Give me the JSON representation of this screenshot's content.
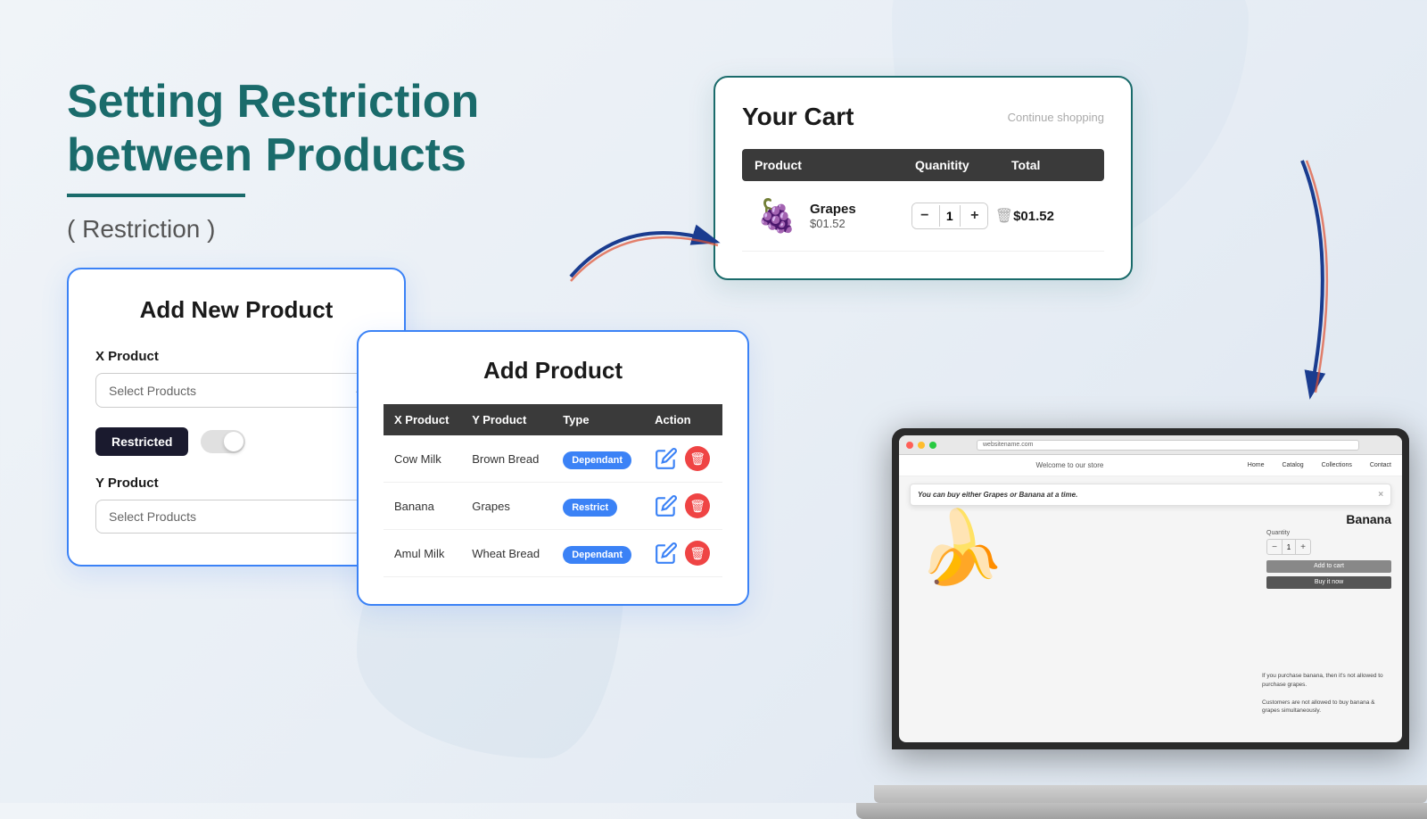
{
  "page": {
    "title": "Setting Restriction between Products",
    "subtitle": "( Restriction )",
    "background_color": "#f0f4f8"
  },
  "add_new_product_card": {
    "title": "Add New Product",
    "x_product_label": "X Product",
    "x_product_placeholder": "Select Products",
    "restricted_label": "Restricted",
    "y_product_label": "Y Product",
    "y_product_placeholder": "Select Products"
  },
  "add_product_card": {
    "title": "Add Product",
    "table": {
      "headers": [
        "X Product",
        "Y Product",
        "Type",
        "Action"
      ],
      "rows": [
        {
          "x": "Cow Milk",
          "y": "Brown Bread",
          "type": "Dependant",
          "type_color": "#3b82f6"
        },
        {
          "x": "Banana",
          "y": "Grapes",
          "type": "Restrict",
          "type_color": "#3b82f6"
        },
        {
          "x": "Amul Milk",
          "y": "Wheat Bread",
          "type": "Dependant",
          "type_color": "#3b82f6"
        }
      ]
    }
  },
  "cart_card": {
    "title": "Your Cart",
    "continue_shopping": "Continue shopping",
    "table_headers": [
      "Product",
      "Quanitity",
      "Total"
    ],
    "item": {
      "name": "Grapes",
      "price": "$01.52",
      "quantity": 1,
      "total": "$01.52",
      "emoji": "🍇"
    }
  },
  "laptop": {
    "url": "websitename.com",
    "store_name": "Welcome to our store",
    "nav_links": [
      "Home",
      "Catalog",
      "Collections",
      "Contact"
    ],
    "product_title": "Banana",
    "qty_label": "Quantity",
    "qty_value": "1",
    "add_to_cart_label": "Add to cart",
    "buy_now_label": "Buy it now",
    "toast_message": "You can buy either Grapes or Banana at a time.",
    "desc_1": "If you purchase banana, then it's not allowed to purchase grapes.",
    "desc_2": "Customers are not allowed to buy banana & grapes simultaneously."
  }
}
